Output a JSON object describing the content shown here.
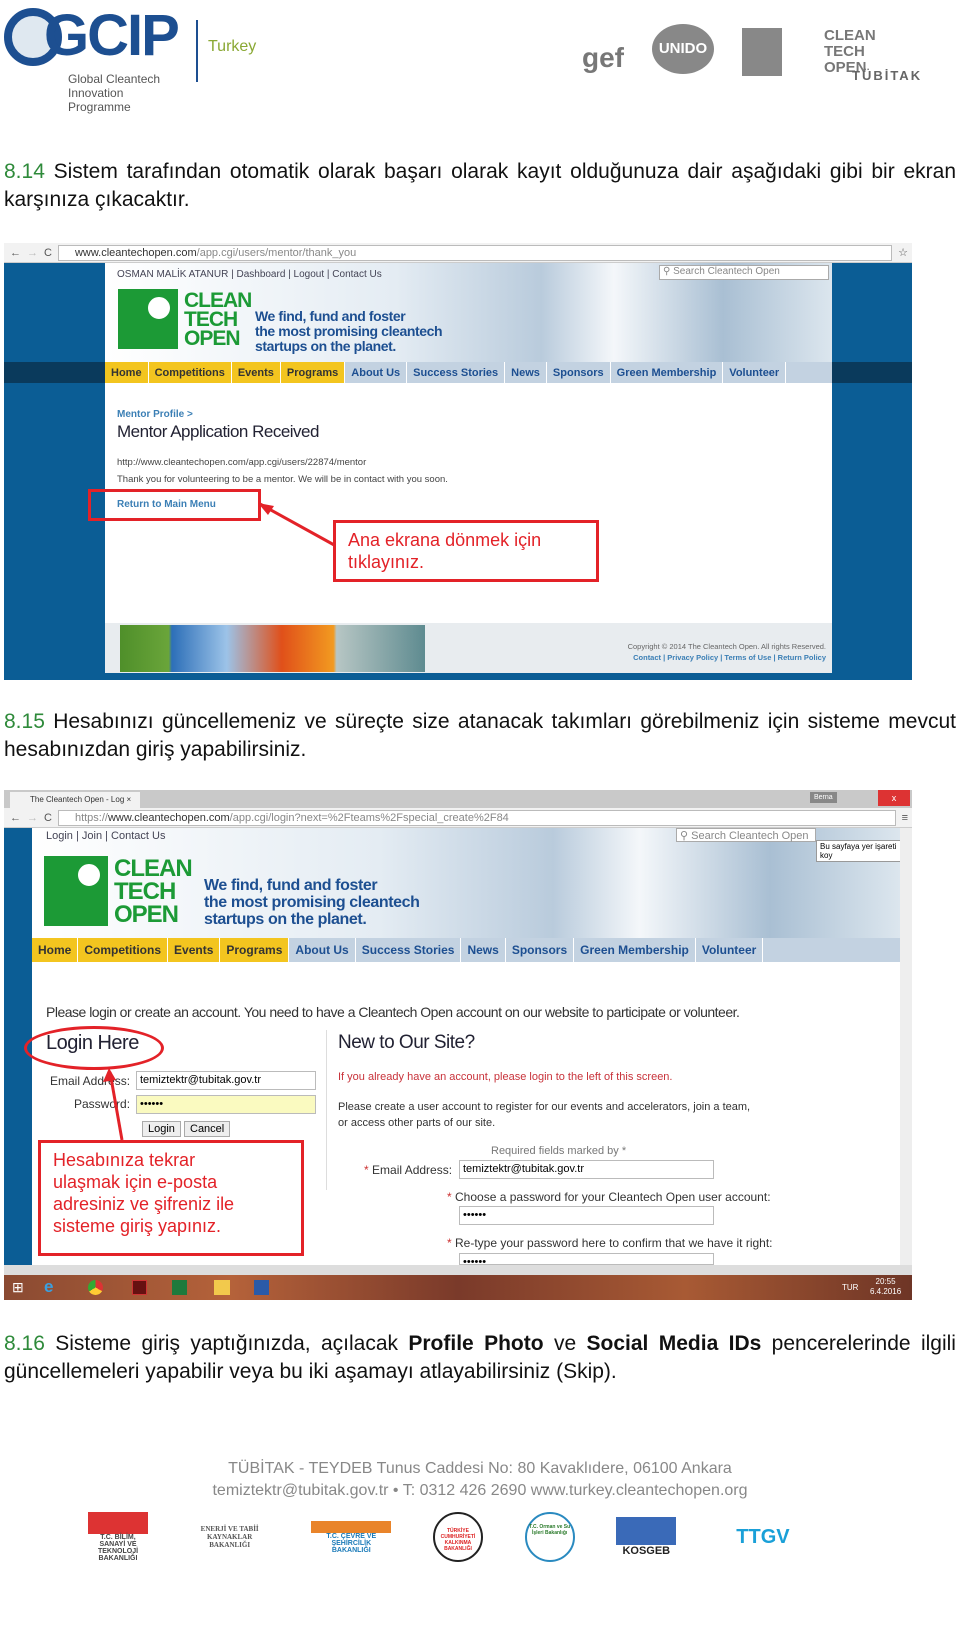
{
  "header": {
    "logo_left": "GCIP",
    "logo_left_sub": "Global Cleantech Innovation Programme",
    "country": "Turkey",
    "partner_logos": [
      "gef",
      "UNIDO",
      "CLEAN TECH OPEN",
      "TÜBİTAK"
    ]
  },
  "sections": [
    {
      "num": "8.14",
      "text": " Sistem tarafından otomatik olarak başarı olarak kayıt olduğunuza dair aşağıdaki gibi bir ekran karşınıza çıkacaktır."
    },
    {
      "num": "8.15",
      "text": " Hesabınızı güncellemeniz ve süreçte size atanacak takımları görebilmeniz için sisteme mevcut hesabınızdan giriş yapabilirsiniz."
    },
    {
      "num": "8.16",
      "t1": " Sisteme giriş yaptığınızda, açılacak ",
      "b1": "Profile Photo",
      "t2": " ve ",
      "b2": "Social Media IDs",
      "t3": " pencerelerinde ilgili güncellemeleri yapabilir veya bu iki aşamayı atlayabilirsiniz (Skip)."
    }
  ],
  "shot1": {
    "url_host": "www.cleantechopen.com",
    "url_path": "/app.cgi/users/mentor/thank_you",
    "toplinks": "OSMAN MALİK ATANUR | Dashboard | Logout | Contact Us",
    "search_placeholder": "Search Cleantech Open",
    "logo": [
      "CLEAN",
      "TECH",
      "OPEN"
    ],
    "tagline": [
      "We find, fund and foster",
      "the most promising cleantech",
      "startups on the planet."
    ],
    "nav": [
      "Home",
      "Competitions",
      "Events",
      "Programs",
      "About Us",
      "Success Stories",
      "News",
      "Sponsors",
      "Green Membership",
      "Volunteer"
    ],
    "breadcrumb": "Mentor Profile >",
    "title": "Mentor Application Received",
    "profile_url": "http://www.cleantechopen.com/app.cgi/users/22874/mentor",
    "message": "Thank you for volunteering to be a mentor. We will be in contact with you soon.",
    "return_link": "Return to Main Menu",
    "callout": [
      "Ana ekrana dönmek için",
      "tıklayınız."
    ],
    "copyright": "Copyright © 2014 The Cleantech Open. All rights Reserved.",
    "footer_links": "Contact | Privacy Policy | Terms of Use | Return Policy"
  },
  "shot2": {
    "tab_title": "The Cleantech Open - Log",
    "user": "Berna",
    "url_scheme": "https://",
    "url_host": "www.cleantechopen.com",
    "url_path": "/app.cgi/login?next=%2Fteams%2Fspecial_create%2F84",
    "toplinks": "Login | Join | Contact Us",
    "search_placeholder": "Search Cleantech Open",
    "bookmark_tooltip": "Bu sayfaya yer işareti koy",
    "intro": "Please login or create an account. You need to have a Cleantech Open account on our website to participate or volunteer.",
    "login_title": "Login Here",
    "email_label": "Email Address:",
    "email_value": "temiztektr@tubitak.gov.tr",
    "password_label": "Password:",
    "password_value": "••••••",
    "login_btn": "Login",
    "cancel_btn": "Cancel",
    "callout": [
      "Hesabınıza tekrar",
      "ulaşmak için e-posta",
      "adresiniz ve şifreniz ile",
      "sisteme giriş yapınız."
    ],
    "new_title": "New to Our Site?",
    "already": "If you already have an account, please login to the left of this screen.",
    "create_info": "Please create a user account to register for our events and accelerators, join a team, or access other parts of our site.",
    "required": "Required fields marked by *",
    "reg_email_label": "Email Address:",
    "reg_email_value": "temiztektr@tubitak.gov.tr",
    "choose_pw": "Choose a password for your Cleantech Open user account:",
    "pw1": "••••••",
    "retype_pw": "Re-type your password here to confirm that we have it right:",
    "pw2": "••••••",
    "taskbar": {
      "lang": "TUR",
      "time": "20:55",
      "date": "6.4.2016"
    }
  },
  "footer": {
    "address": "TÜBİTAK - TEYDEB Tunus Caddesi No: 80 Kavaklıdere, 06100 Ankara",
    "contact": "temiztektr@tubitak.gov.tr • T:  0312 426 2690 www.turkey.cleantechopen.org",
    "logos": [
      "T.C. BİLİM, SANAYİ VE TEKNOLOJİ BAKANLIĞI",
      "ENERJİ VE TABİİ KAYNAKLAR BAKANLIĞI",
      "T.C. ÇEVRE VE ŞEHİRCİLİK BAKANLIĞI",
      "TÜRKİYE CUMHURİYETİ KALKINMA BAKANLIĞI",
      "T.C. Orman ve Su İşleri Bakanlığı",
      "KOSGEB",
      "TTGV"
    ]
  },
  "colors": {
    "accent_green": "#2e8a3a",
    "annotation_red": "#e32228",
    "site_blue": "#1d4f91",
    "nav_yellow": "#f3c51f"
  }
}
